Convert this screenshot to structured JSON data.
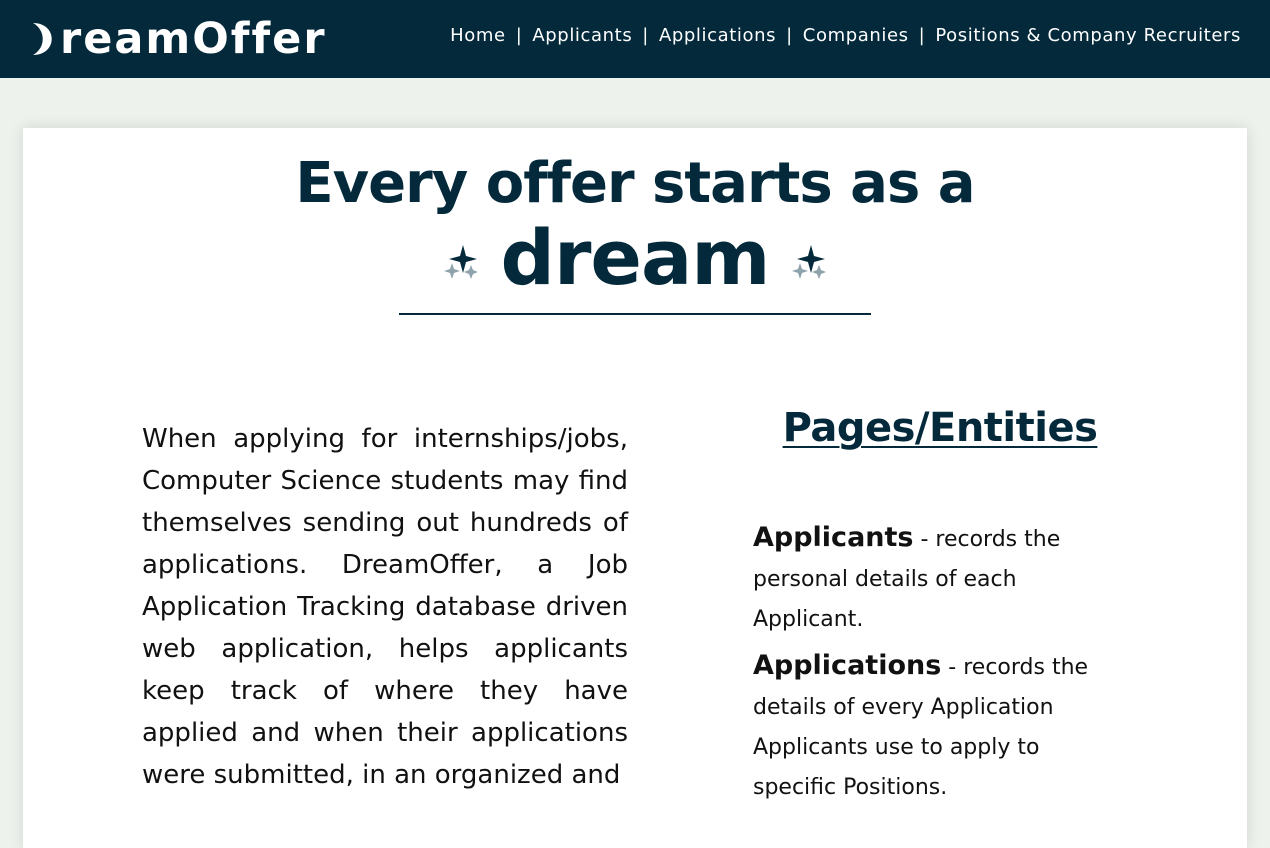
{
  "header": {
    "logo_text": "reamOffer",
    "logo_icon": "moon-icon",
    "nav": {
      "home": "Home",
      "applicants": "Applicants",
      "applications": "Applications",
      "companies": "Companies",
      "positions": "Positions & Company Recruiters",
      "separator": "|"
    }
  },
  "hero": {
    "headline": "Every offer starts as a",
    "highlight": "dream",
    "sparkle_icon": "sparkles-icon"
  },
  "intro": {
    "text": "When applying for internships/jobs, Computer Science students may find themselves sending out hundreds of applications. DreamOffer, a Job Application Tracking database driven web application, helps applicants keep track of where they have applied and when their applications were submitted, in an organized and"
  },
  "entities": {
    "title": "Pages/Entities",
    "items": [
      {
        "name": "Applicants",
        "description": " - records the personal details of each Applicant."
      },
      {
        "name": "Applications",
        "description": " - records the details of every Application Applicants use to apply to specific Positions."
      }
    ]
  },
  "colors": {
    "navy": "#03293b",
    "page_bg": "#edf2ed",
    "card_bg": "#ffffff",
    "sparkle_light": "#8fa3ad"
  }
}
